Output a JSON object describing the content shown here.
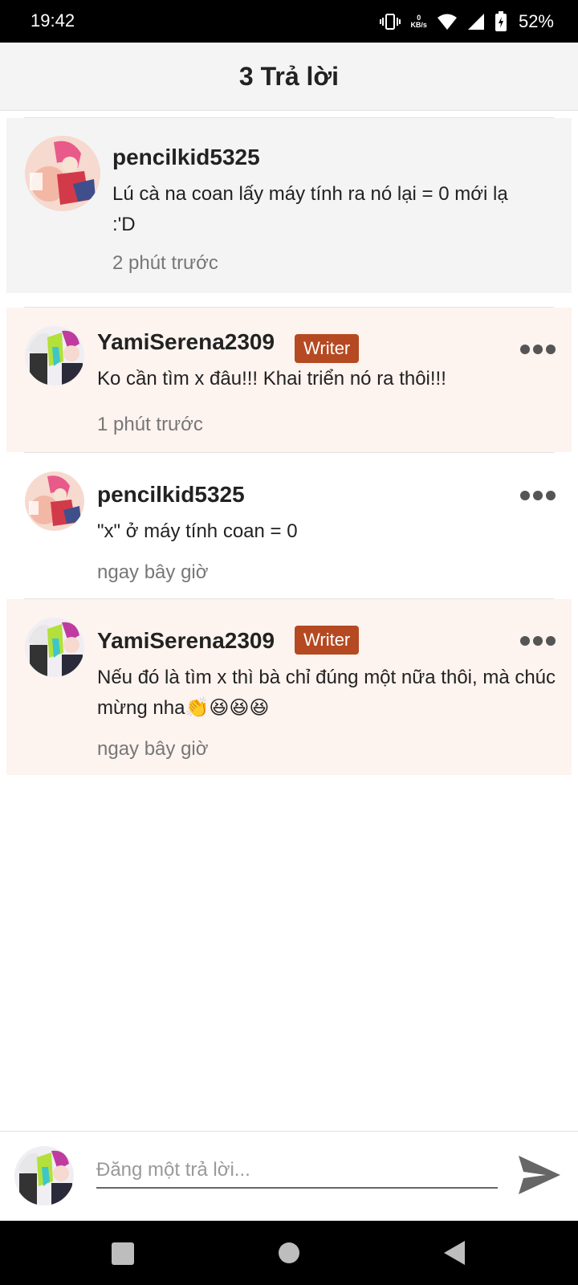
{
  "status_bar": {
    "time": "19:42",
    "net_speed_value": "0",
    "net_speed_unit": "KB/s",
    "battery_percent": "52%"
  },
  "header": {
    "title": "3 Trả lời"
  },
  "comments": [
    {
      "username": "pencilkid5325",
      "badge": "",
      "text": "Lú cà na coan lấy máy tính ra nó lại = 0 mới lạ :'D",
      "time": "2 phút trước"
    },
    {
      "username": "YamiSerena2309",
      "badge": "Writer",
      "text": "Ko cần tìm x đâu!!! Khai triển nó ra thôi!!!",
      "time": "1 phút trước"
    },
    {
      "username": "pencilkid5325",
      "badge": "",
      "text": "\"x\" ở máy tính coan = 0",
      "time": "ngay bây giờ"
    },
    {
      "username": "YamiSerena2309",
      "badge": "Writer",
      "text": "Nếu đó là tìm x thì bà chỉ đúng một nữa thôi, mà chúc mừng nha👏😆😆😆",
      "time": "ngay bây giờ"
    }
  ],
  "reply": {
    "placeholder": "Đăng một trả lời..."
  },
  "colors": {
    "writer_badge": "#b54a22",
    "writer_bg": "#fdf3ef",
    "parent_bg": "#f4f4f4"
  }
}
